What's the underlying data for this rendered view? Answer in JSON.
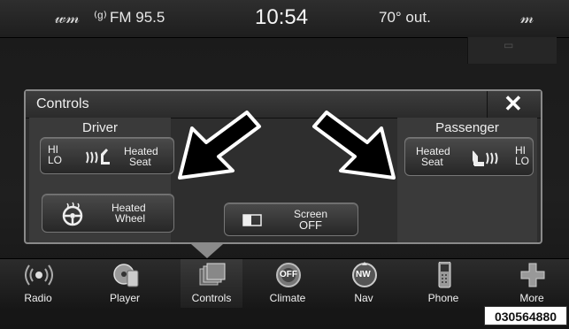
{
  "status": {
    "radio": "FM 95.5",
    "time": "10:54",
    "outside_temp": "70° out."
  },
  "panel": {
    "title": "Controls",
    "close": "✕",
    "driver": {
      "heading": "Driver",
      "heated_seat": {
        "hi": "HI",
        "lo": "LO",
        "label_line1": "Heated",
        "label_line2": "Seat"
      },
      "heated_wheel": {
        "label_line1": "Heated",
        "label_line2": "Wheel"
      }
    },
    "screen_off": {
      "label_line1": "Screen",
      "label_line2": "OFF"
    },
    "passenger": {
      "heading": "Passenger",
      "heated_seat": {
        "hi": "HI",
        "lo": "LO",
        "label_line1": "Heated",
        "label_line2": "Seat"
      }
    }
  },
  "nav": [
    {
      "label": "Radio",
      "icon": "radio-icon"
    },
    {
      "label": "Player",
      "icon": "player-icon"
    },
    {
      "label": "Controls",
      "icon": "controls-icon",
      "selected": true
    },
    {
      "label": "Climate",
      "icon": "climate-icon"
    },
    {
      "label": "Nav",
      "icon": "nav-icon",
      "badge": "NW"
    },
    {
      "label": "Phone",
      "icon": "phone-icon"
    },
    {
      "label": "More",
      "icon": "more-icon"
    }
  ],
  "climate_badge": "OFF",
  "image_code": "030564880"
}
